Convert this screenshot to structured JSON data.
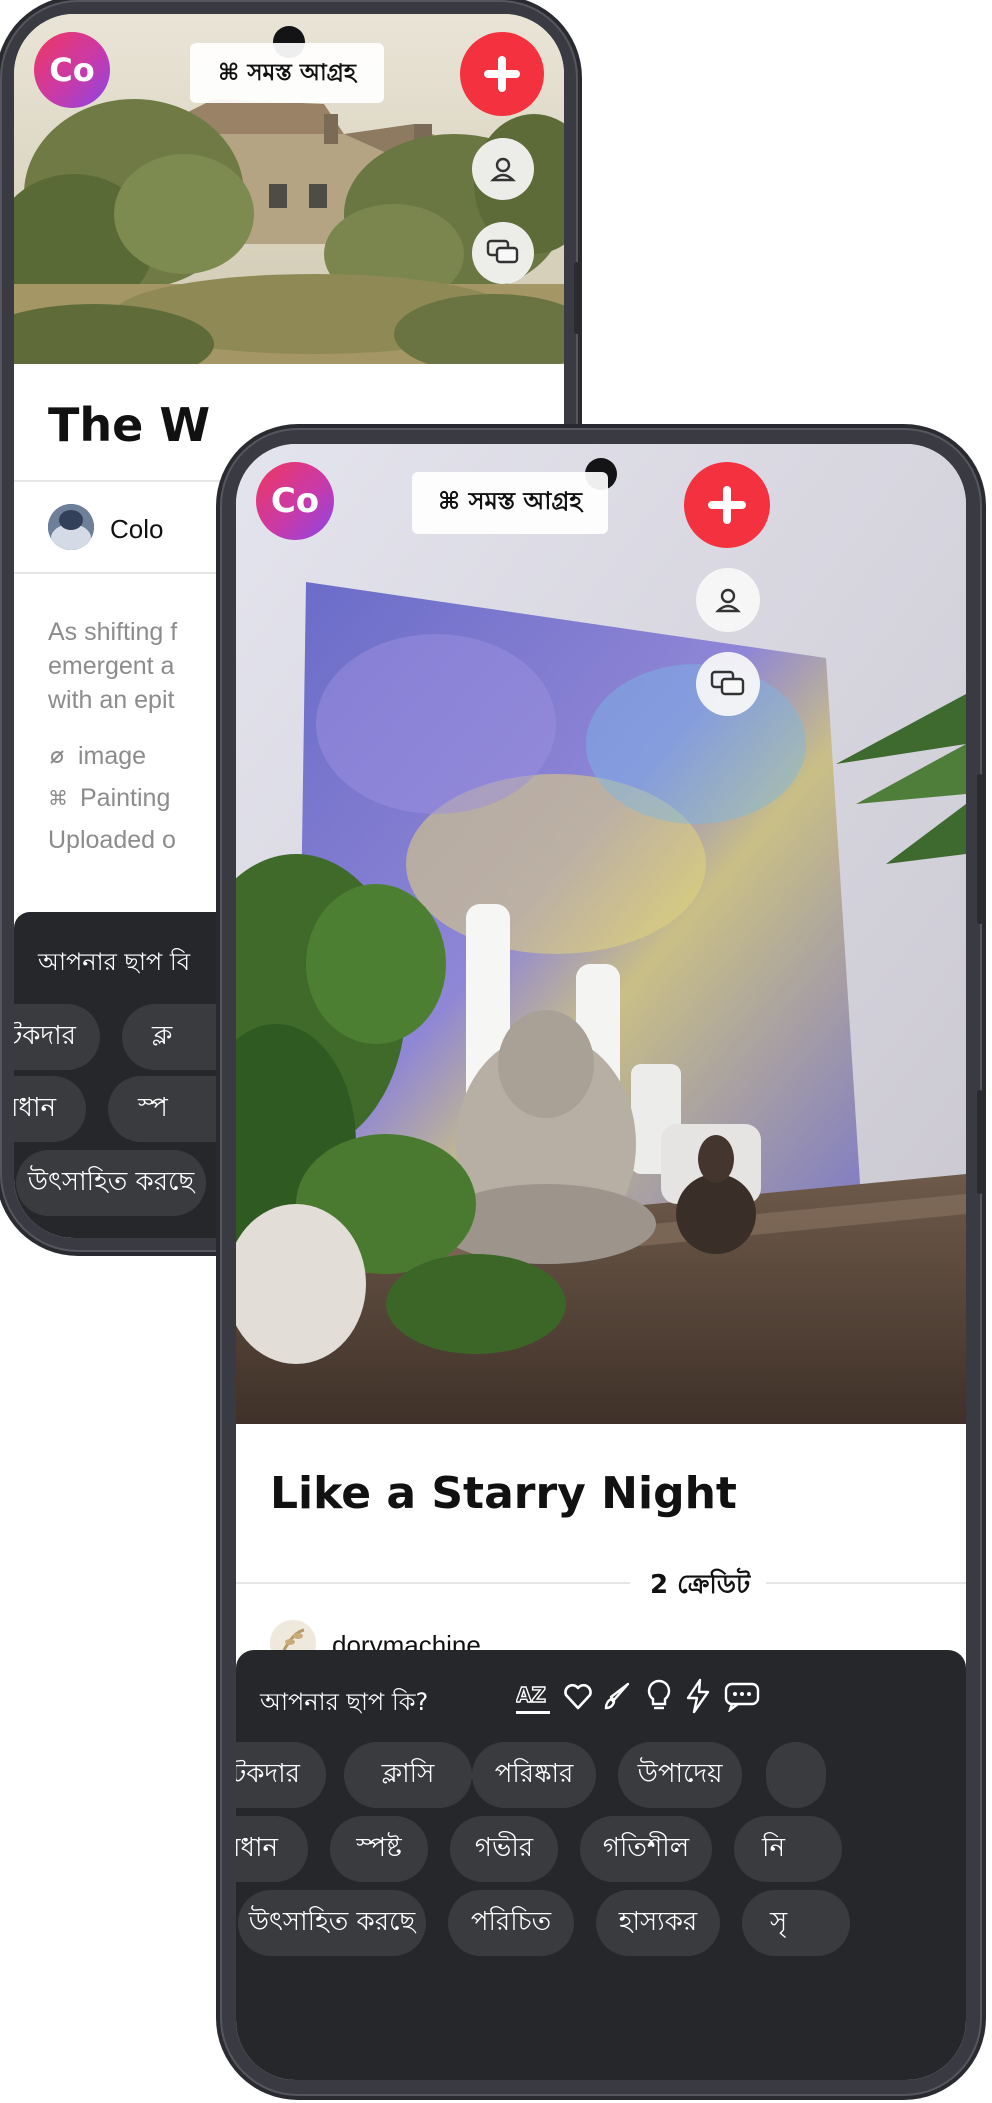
{
  "back_phone": {
    "logo_label": "Co",
    "interest_label": "⌘ সমস্ত আগ্রহ",
    "title": "The W",
    "author": "Colo",
    "description": [
      "As shifting f",
      "emergent a",
      "with an epit"
    ],
    "tag_type": "image",
    "tag_category": "Painting",
    "uploaded": "Uploaded o",
    "prompt": "আপনার ছাপ বি",
    "chips_row1": [
      "টকদার",
      "ক্ল"
    ],
    "chips_row2": [
      "বধান",
      "স্প"
    ],
    "chips_row3": [
      "উৎসাহিত করছে"
    ]
  },
  "front_phone": {
    "logo_label": "Co",
    "interest_label": "⌘ সমস্ত আগ্রহ",
    "title": "Like a Starry Night",
    "credits": "2 ক্রেডিট",
    "author": "dorymachine",
    "prompt": "আপনার ছাপ কি?",
    "filter_icons": [
      "az-sort-icon",
      "heart-icon",
      "brush-icon",
      "lightbulb-icon",
      "bolt-icon",
      "chat-dots-icon"
    ],
    "chips_row1": [
      "টকদার",
      "ক্লাসি",
      "পরিষ্কার",
      "উপাদেয়",
      ""
    ],
    "chips_row2": [
      "বধান",
      "স্পষ্ট",
      "গভীর",
      "গতিশীল",
      "নি"
    ],
    "chips_row3": [
      "উৎসাহিত করছে",
      "পরিচিত",
      "হাস্যকর",
      "সৃ"
    ]
  },
  "colors": {
    "accent_red": "#f4313e",
    "panel_dark": "#26272b",
    "chip_bg": "#3a3b3f",
    "frame": "#3a3b42"
  }
}
